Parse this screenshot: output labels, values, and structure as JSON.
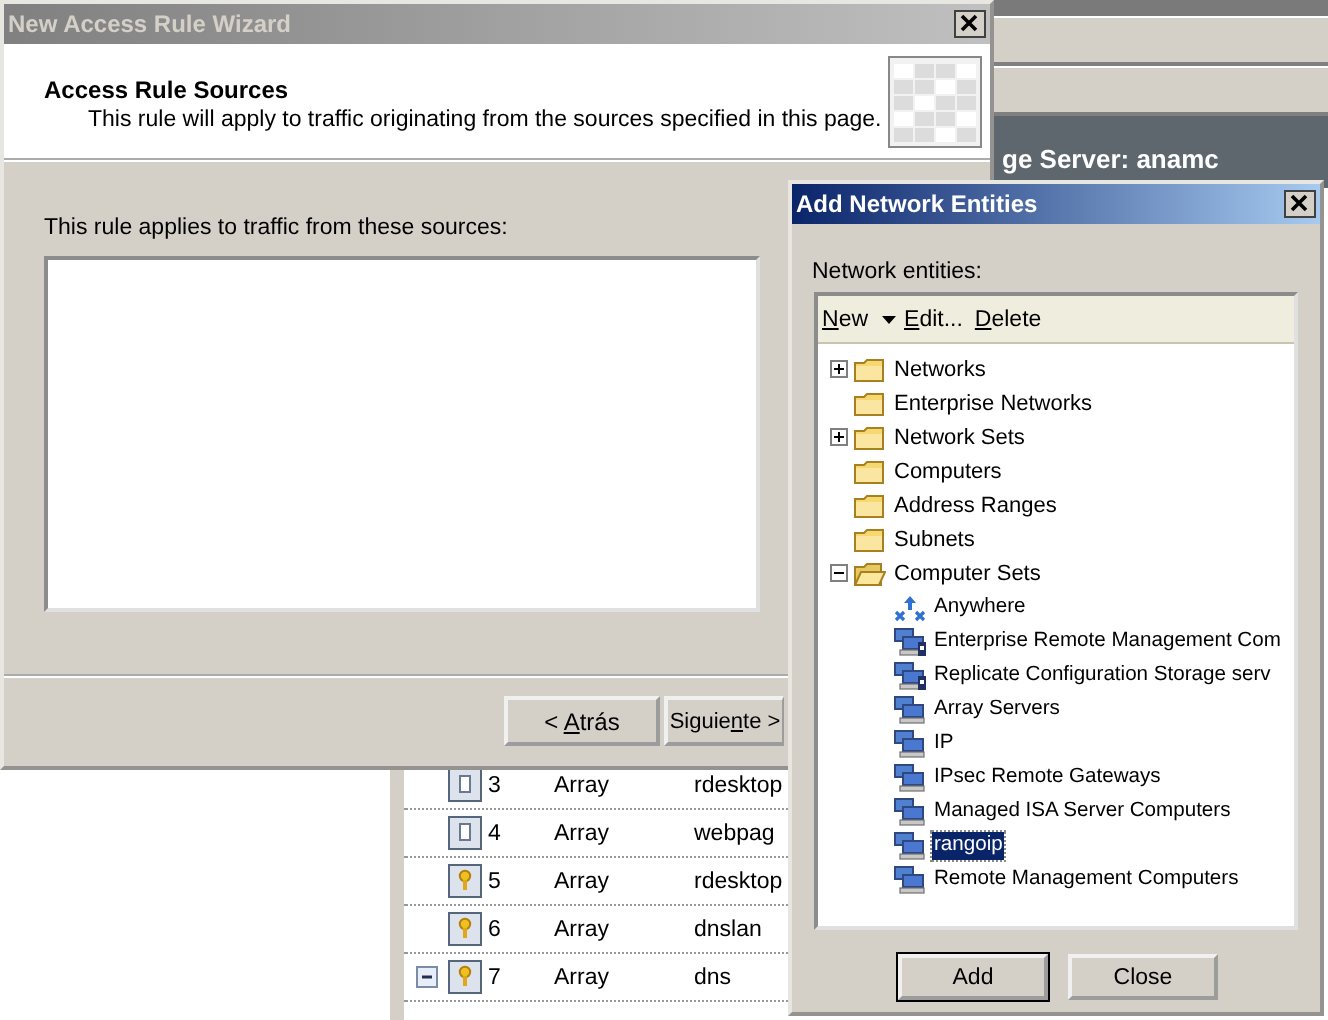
{
  "console": {
    "header_title": "ge Server: anamc",
    "rules": [
      {
        "kind": "publish",
        "number": "3",
        "source": "Array",
        "name": "rdesktop"
      },
      {
        "kind": "publish",
        "number": "4",
        "source": "Array",
        "name": "webpag"
      },
      {
        "kind": "access",
        "number": "5",
        "source": "Array",
        "name": "rdesktop"
      },
      {
        "kind": "access",
        "number": "6",
        "source": "Array",
        "name": "dnslan"
      },
      {
        "kind": "access",
        "number": "7",
        "source": "Array",
        "name": "dns",
        "expanded": true
      }
    ]
  },
  "wizard": {
    "title": "New Access Rule Wizard",
    "header_title": "Access Rule Sources",
    "header_subtitle": "This rule will apply to traffic originating from the sources specified in this page.",
    "sources_label": "This rule applies to traffic from these sources:",
    "buttons": [
      {
        "before": "< ",
        "key": "A",
        "after": "trás"
      },
      {
        "before": "Siguie",
        "key": "n",
        "after": "te >"
      }
    ]
  },
  "dialog": {
    "title": "Add Network Entities",
    "list_label": "Network entities:",
    "toolbar": [
      {
        "key": "N",
        "after": "ew",
        "dropdown": true
      },
      {
        "key": "E",
        "after": "dit..."
      },
      {
        "key": "D",
        "after": "elete"
      }
    ],
    "tree": [
      {
        "kind": "folder",
        "label": "Networks",
        "expanded": false,
        "selected": false
      },
      {
        "kind": "folder",
        "label": "Enterprise Networks",
        "selected": false
      },
      {
        "kind": "folder",
        "label": "Network Sets",
        "expanded": false,
        "selected": false
      },
      {
        "kind": "folder",
        "label": "Computers",
        "selected": false
      },
      {
        "kind": "folder",
        "label": "Address Ranges",
        "selected": false
      },
      {
        "kind": "folder",
        "label": "Subnets",
        "selected": false
      },
      {
        "kind": "folder",
        "label": "Computer Sets",
        "expanded": true,
        "selected": false,
        "children": [
          {
            "kind": "anywhere",
            "label": "Anywhere",
            "selected": false
          },
          {
            "kind": "locked-set",
            "label": "Enterprise Remote Management Com",
            "selected": false
          },
          {
            "kind": "locked-set",
            "label": "Replicate Configuration Storage serv",
            "selected": false
          },
          {
            "kind": "computer-set",
            "label": "Array Servers",
            "selected": false
          },
          {
            "kind": "computer-set",
            "label": "IP",
            "selected": false
          },
          {
            "kind": "computer-set",
            "label": "IPsec Remote Gateways",
            "selected": false
          },
          {
            "kind": "computer-set",
            "label": "Managed ISA Server Computers",
            "selected": false
          },
          {
            "kind": "computer-set",
            "label": "rangoip",
            "selected": true
          },
          {
            "kind": "computer-set",
            "label": "Remote Management Computers",
            "selected": false
          }
        ]
      }
    ],
    "buttons": [
      {
        "label": "Add",
        "default": true
      },
      {
        "label": "Close",
        "default": false
      }
    ]
  }
}
